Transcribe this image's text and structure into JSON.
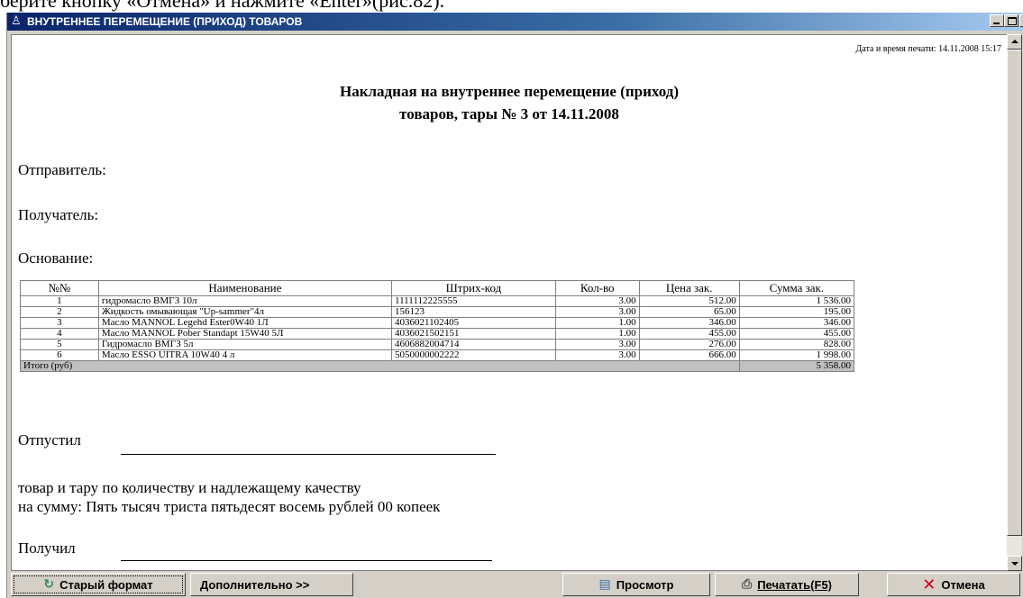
{
  "background_caption": "берите кнопку «Отмена» и нажмите «Enter»(рис.82).",
  "window": {
    "title": "ВНУТРЕННЕЕ ПЕРЕМЕЩЕНИЕ (ПРИХОД) ТОВАРОВ",
    "title_icon": "app-icon",
    "controls": [
      "minimize",
      "maximize",
      "close"
    ]
  },
  "document": {
    "print_date": "Дата и время печати: 14.11.2008 15:17",
    "title_line1": "Накладная на внутреннее перемещение (приход)",
    "title_line2": "товаров, тары   № 3 от  14.11.2008",
    "sender_label": "Отправитель:",
    "recipient_label": "Получатель:",
    "basis_label": "Основание:",
    "table": {
      "headers": [
        "№№",
        "Наименование",
        "Штрих-код",
        "Кол-во",
        "Цена зак.",
        "Сумма зак."
      ],
      "rows": [
        [
          "1",
          "гидромасло ВМГЗ 10л",
          "1111112225555",
          "3.00",
          "512.00",
          "1 536.00"
        ],
        [
          "2",
          "Жидкость омывающая \"Up-sammer\"4л",
          "156123",
          "3.00",
          "65.00",
          "195.00"
        ],
        [
          "3",
          "Масло MANNOL Legehd Ester0W40 1Л",
          "4036021102405",
          "1.00",
          "346.00",
          "346.00"
        ],
        [
          "4",
          "Масло MANNOL Pober Standapt 15W40 5Л",
          "4036021502151",
          "1.00",
          "455.00",
          "455.00"
        ],
        [
          "5",
          "Гидромасло ВМГЗ 5л",
          "4606882004714",
          "3.00",
          "276.00",
          "828.00"
        ],
        [
          "6",
          "Масло ESSO UITRA 10W40 4 л",
          "5050000002222",
          "3.00",
          "666.00",
          "1 998.00"
        ]
      ],
      "total_label": "Итого (руб)",
      "total_value": "5 358.00"
    },
    "released_label": "Отпустил",
    "goods_line": "товар и тару по количеству и надлежащему качеству",
    "sum_line": "на сумму: Пять тысяч триста пятьдесят восемь рублей 00 копеек",
    "received_label": "Получил"
  },
  "buttons": {
    "old_format": "Старый формат",
    "old_format_icon": "refresh-icon",
    "more": "Дополнительно >>",
    "preview": "Просмотр",
    "preview_icon": "document-icon",
    "print": "Печатать(F5)",
    "print_icon": "printer-icon",
    "cancel": "Отмена",
    "cancel_icon": "red-x-icon",
    "cancel_color": "#cc0000"
  }
}
